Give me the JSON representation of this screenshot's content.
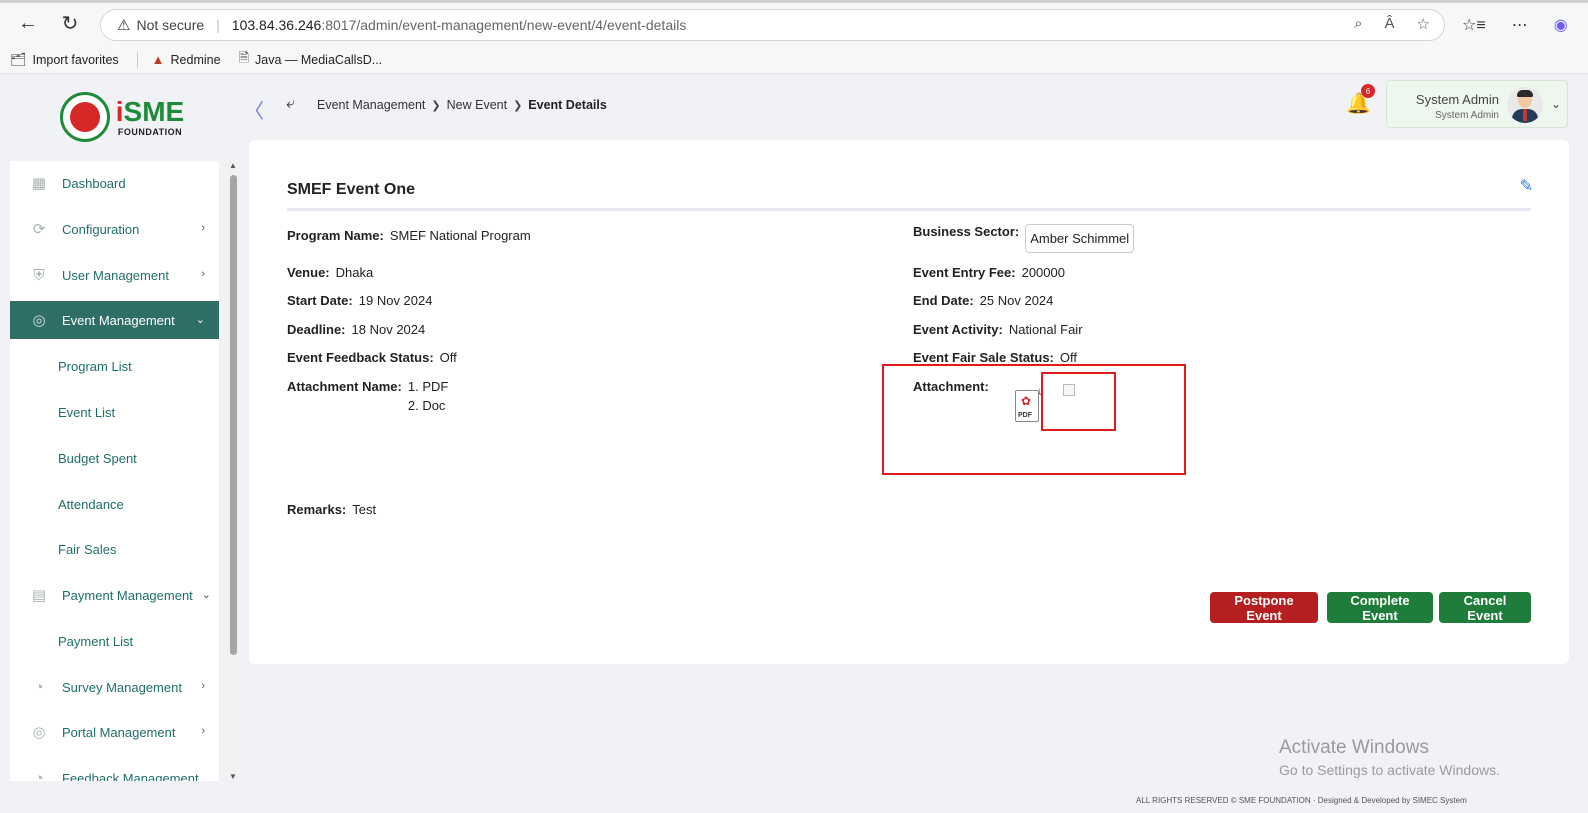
{
  "browser": {
    "security": "Not secure",
    "url_host": "103.84.36.246",
    "url_path": ":8017/admin/event-management/new-event/4/event-details",
    "favorites": [
      {
        "label": "Import favorites"
      },
      {
        "label": "Redmine"
      },
      {
        "label": "Java — MediaCallsD..."
      }
    ]
  },
  "logo": {
    "brand": "SME",
    "sub": "FOUNDATION"
  },
  "breadcrumb": [
    "Event Management",
    "New Event",
    "Event Details"
  ],
  "notifications": {
    "count": "6"
  },
  "user": {
    "name": "System Admin",
    "role": "System Admin"
  },
  "sidebar": {
    "items": [
      {
        "label": "Dashboard"
      },
      {
        "label": "Configuration"
      },
      {
        "label": "User Management"
      },
      {
        "label": "Event Management"
      },
      {
        "label": "Program List"
      },
      {
        "label": "Event List"
      },
      {
        "label": "Budget Spent"
      },
      {
        "label": "Attendance"
      },
      {
        "label": "Fair Sales"
      },
      {
        "label": "Payment Management"
      },
      {
        "label": "Payment List"
      },
      {
        "label": "Survey Management"
      },
      {
        "label": "Portal Management"
      },
      {
        "label": "Feedback Management"
      }
    ]
  },
  "event": {
    "title": "SMEF Event One",
    "program_name_label": "Program Name:",
    "program_name": "SMEF National Program",
    "business_sector_label": "Business Sector:",
    "business_sector": "Amber Schimmel",
    "venue_label": "Venue:",
    "venue": "Dhaka",
    "entry_fee_label": "Event Entry Fee:",
    "entry_fee": "200000",
    "start_date_label": "Start Date:",
    "start_date": "19 Nov 2024",
    "end_date_label": "End Date:",
    "end_date": "25 Nov 2024",
    "deadline_label": "Deadline:",
    "deadline": "18 Nov 2024",
    "activity_label": "Event Activity:",
    "activity": "National Fair",
    "feedback_status_label": "Event Feedback Status:",
    "feedback_status": "Off",
    "fair_sale_status_label": "Event Fair Sale Status:",
    "fair_sale_status": "Off",
    "attachment_name_label": "Attachment Name:",
    "attachment_names": [
      "1. PDF",
      "2. Doc"
    ],
    "attachment_label": "Attachment:",
    "pdf_icon_text": "PDF",
    "remarks_label": "Remarks:",
    "remarks": "Test"
  },
  "actions": {
    "postpone": "Postpone Event",
    "complete": "Complete Event",
    "cancel": "Cancel Event"
  },
  "watermark": {
    "line1": "Activate Windows",
    "line2": "Go to Settings to activate Windows."
  },
  "footer": "ALL RIGHTS RESERVED © SME FOUNDATION · Designed & Developed by SIMEC System"
}
